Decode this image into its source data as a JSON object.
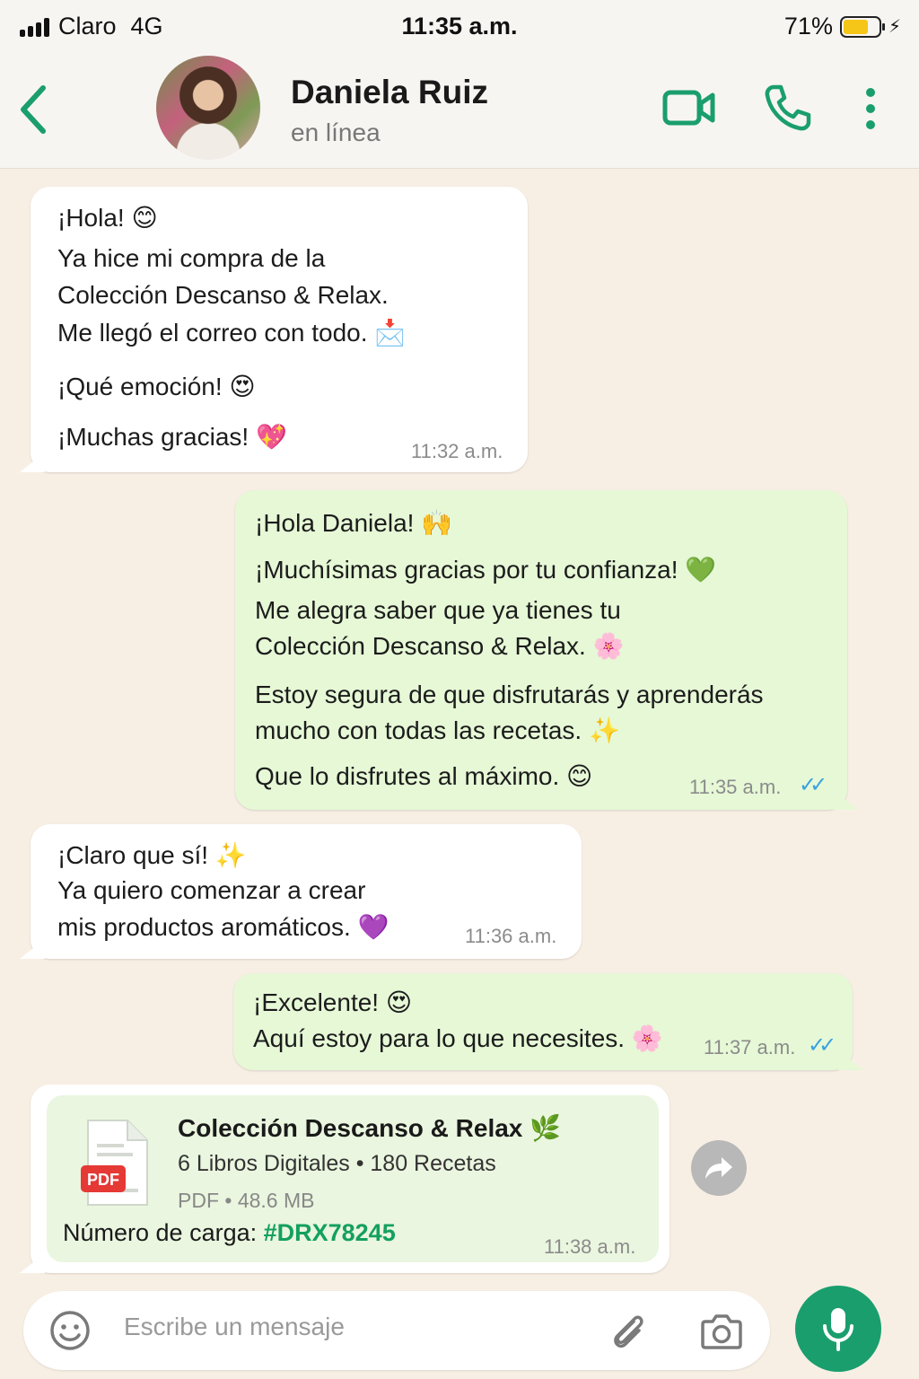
{
  "status_bar": {
    "carrier": "Claro",
    "network": "4G",
    "time": "11:35 a.m.",
    "battery": "71%",
    "battery_level": 0.71
  },
  "header": {
    "name": "Daniela Ruiz",
    "status": "en línea",
    "icons": [
      "back-arrow-icon",
      "video-call-icon",
      "phone-call-icon",
      "more-options-icon"
    ],
    "accent_color": "#1a9e6e"
  },
  "messages": [
    {
      "direction": "in",
      "lines": [
        "¡Hola! 😊",
        "Ya hice mi compra de la",
        "Colección Descanso & Relax.",
        "Me llegó el correo con todo. 📩",
        "¡Qué emoción! 😍",
        "¡Muchas gracias! 💖"
      ],
      "time": "11:32 a.m."
    },
    {
      "direction": "out",
      "lines": [
        "¡Hola Daniela! 🙌",
        "¡Muchísimas gracias por tu confianza! 💚",
        "Me alegra saber que ya tienes tu",
        "Colección Descanso & Relax.  🌸",
        "Estoy segura de que disfrutarás y aprenderás",
        "mucho con todas las recetas. ✨",
        "Que lo disfrutes al máximo. 😊"
      ],
      "time": "11:35 a.m.",
      "ticks": "✓✓"
    },
    {
      "direction": "in",
      "lines": [
        "¡Claro que sí!  ✨",
        "Ya quiero comenzar a crear",
        "mis productos aromáticos. 💜"
      ],
      "time": "11:36 a.m."
    },
    {
      "direction": "out",
      "lines": [
        "¡Excelente! 😍",
        "Aquí estoy para lo que necesites. 🌸"
      ],
      "time": "11:37 a.m.",
      "ticks": "✓✓"
    }
  ],
  "file_message": {
    "title": "Colección Descanso & Relax 🌿",
    "subtitle": "6 Libros Digitales • 180 Recetas",
    "meta": "PDF • 48.6 MB",
    "badge": "PDF",
    "carga_label": "Número de carga: ",
    "carga_code": "#DRX78245",
    "time": "11:38 a.m.",
    "action_icon": "forward-icon"
  },
  "input": {
    "placeholder": "Escribe un mensaje",
    "icons": [
      "emoji-icon",
      "attach-icon",
      "camera-icon",
      "mic-icon"
    ]
  }
}
